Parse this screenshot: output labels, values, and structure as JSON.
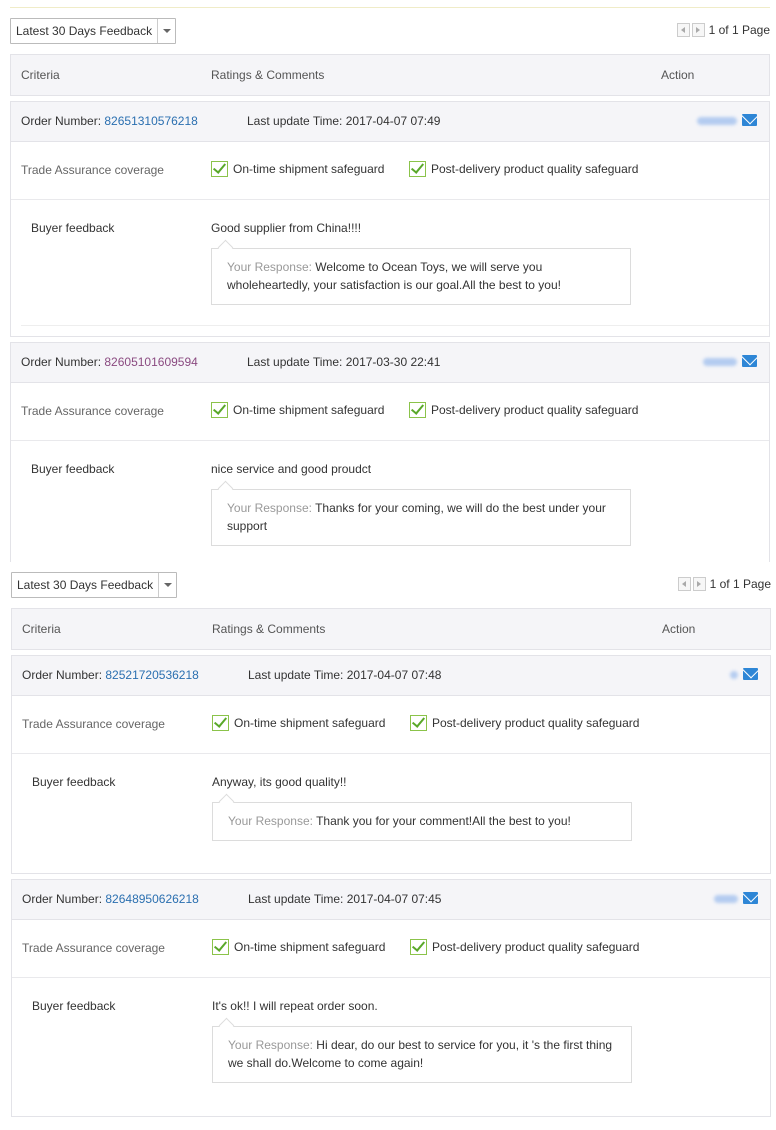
{
  "sections": [
    {
      "filter_label": "Latest 30 Days Feedback",
      "pager_text": "1 of 1 Page",
      "columns": {
        "criteria": "Criteria",
        "ratings": "Ratings & Comments",
        "action": "Action"
      },
      "cards": [
        {
          "order_label": "Order Number:",
          "order_number": "82651310576218",
          "update_label": "Last update Time:",
          "update_time": "2017-04-07 07:49",
          "ta_label": "Trade Assurance coverage",
          "safeguard1": "On-time shipment safeguard",
          "safeguard2": "Post-delivery product quality safeguard",
          "fb_label": "Buyer feedback",
          "feedback": "Good supplier from China!!!!",
          "response_prefix": "Your Response:",
          "response": " Welcome to Ocean Toys, we will serve you wholeheartedly, your satisfaction is our goal.All the best to you!"
        },
        {
          "order_label": "Order Number:",
          "order_number": "82605101609594",
          "update_label": "Last update Time:",
          "update_time": "2017-03-30 22:41",
          "ta_label": "Trade Assurance coverage",
          "safeguard1": "On-time shipment safeguard",
          "safeguard2": "Post-delivery product quality safeguard",
          "fb_label": "Buyer feedback",
          "feedback": "nice service and good proudct",
          "response_prefix": "Your Response:",
          "response": " Thanks for your coming, we will do the best under your support"
        }
      ]
    },
    {
      "filter_label": "Latest 30 Days Feedback",
      "pager_text": "1 of 1 Page",
      "columns": {
        "criteria": "Criteria",
        "ratings": "Ratings & Comments",
        "action": "Action"
      },
      "cards": [
        {
          "order_label": "Order Number:",
          "order_number": "82521720536218",
          "update_label": "Last update Time:",
          "update_time": "2017-04-07 07:48",
          "ta_label": "Trade Assurance coverage",
          "safeguard1": "On-time shipment safeguard",
          "safeguard2": "Post-delivery product quality safeguard",
          "fb_label": "Buyer feedback",
          "feedback": "Anyway, its good quality!!",
          "response_prefix": "Your Response:",
          "response": " Thank you for your comment!All the best to you!"
        },
        {
          "order_label": "Order Number:",
          "order_number": "82648950626218",
          "update_label": "Last update Time:",
          "update_time": "2017-04-07 07:45",
          "ta_label": "Trade Assurance coverage",
          "safeguard1": "On-time shipment safeguard",
          "safeguard2": "Post-delivery product quality safeguard",
          "fb_label": "Buyer feedback",
          "feedback": "It's ok!! I will repeat order soon.",
          "response_prefix": "Your Response:",
          "response": " Hi dear, do our best to service for you, it 's the first thing we shall do.Welcome to come again!"
        }
      ]
    }
  ],
  "colors": {
    "link": "#2a6fb0",
    "visited_link": "#8a4a80",
    "check": "#8bc34a",
    "mail": "#2e86d6"
  }
}
